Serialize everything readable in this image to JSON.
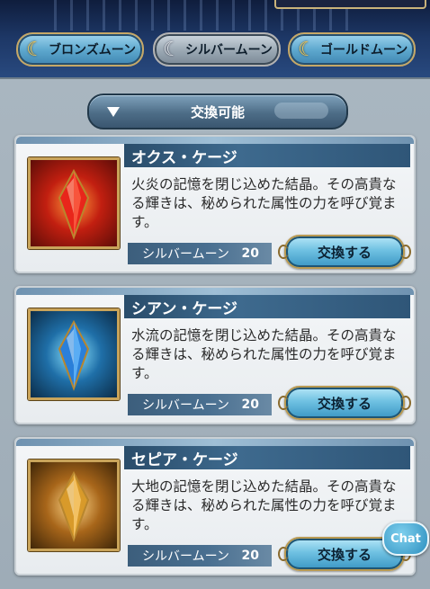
{
  "tabs": [
    {
      "label": "ブロンズムーン",
      "active": false,
      "icon": "crescent-moon-gold-icon"
    },
    {
      "label": "シルバームーン",
      "active": true,
      "icon": "crescent-moon-silver-icon"
    },
    {
      "label": "ゴールドムーン",
      "active": false,
      "icon": "crescent-moon-gold-icon"
    }
  ],
  "filter": {
    "label": "交換可能",
    "icon": "triangle-down-icon"
  },
  "items": [
    {
      "name": "オクス・ケージ",
      "description": "火炎の記憶を閉じ込めた結晶。その高貴なる輝きは、秘められた属性の力を呼び覚ます。",
      "cost_currency": "シルバームーン",
      "cost": "20",
      "button": "交換する",
      "icon": "red-crystal-icon",
      "crystal_color": "#d8261d"
    },
    {
      "name": "シアン・ケージ",
      "description": "水流の記憶を閉じ込めた結晶。その高貴なる輝きは、秘められた属性の力を呼び覚ます。",
      "cost_currency": "シルバームーン",
      "cost": "20",
      "button": "交換する",
      "icon": "blue-crystal-icon",
      "crystal_color": "#2a7fd9"
    },
    {
      "name": "セピア・ケージ",
      "description": "大地の記憶を閉じ込めた結晶。その高貴なる輝きは、秘められた属性の力を呼び覚ます。",
      "cost_currency": "シルバームーン",
      "cost": "20",
      "button": "交換する",
      "icon": "amber-crystal-icon",
      "crystal_color": "#d89a2a"
    }
  ],
  "chat": {
    "label": "Chat",
    "icon": "chat-bubble-icon"
  }
}
